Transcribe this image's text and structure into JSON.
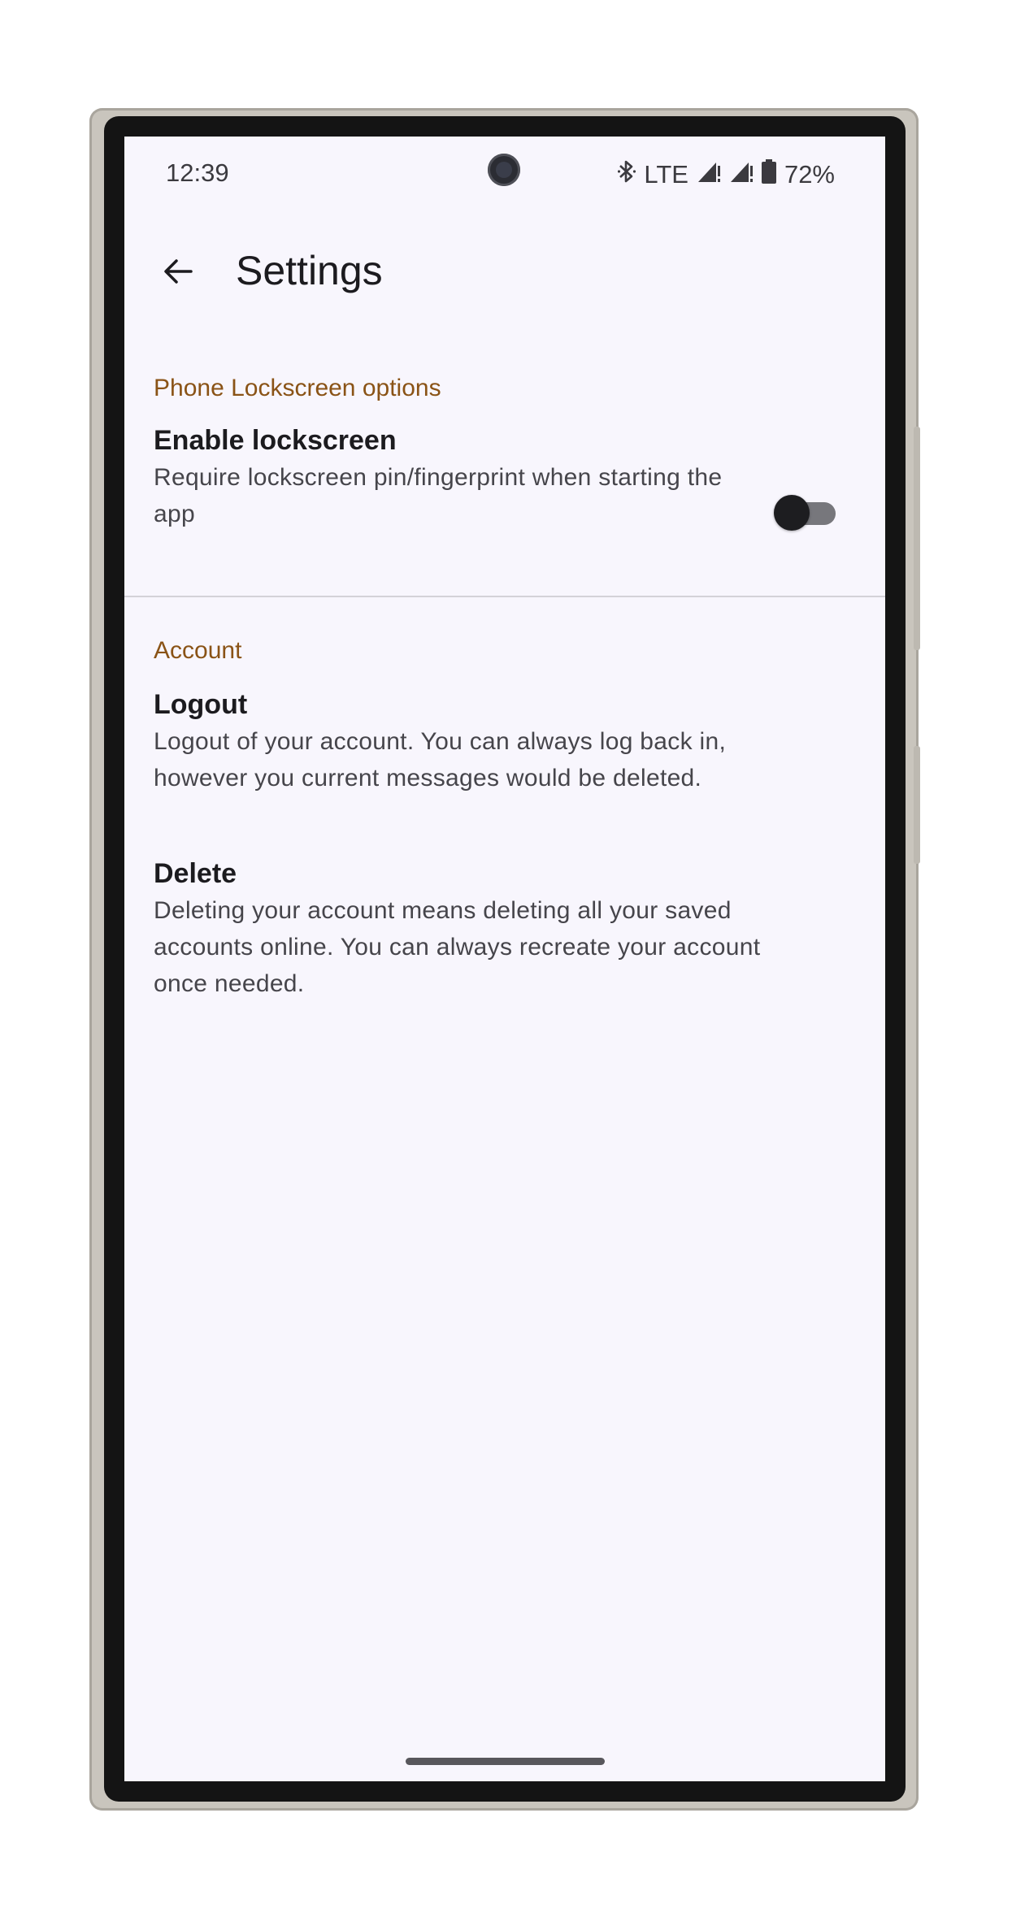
{
  "status_bar": {
    "time": "12:39",
    "network": "LTE",
    "battery_percent": "72%",
    "icons": [
      "bluetooth-icon",
      "signal-icon",
      "signal-icon",
      "battery-icon"
    ]
  },
  "app_bar": {
    "title": "Settings",
    "back_icon": "arrow-left-icon"
  },
  "sections": [
    {
      "header": "Phone Lockscreen options",
      "items": [
        {
          "title": "Enable lockscreen",
          "summary": "Require lockscreen pin/fingerprint when starting the app",
          "toggle_on": false
        }
      ]
    },
    {
      "header": "Account",
      "items": [
        {
          "title": "Logout",
          "summary": "Logout of your account. You can always log back in, however you current messages would be deleted."
        },
        {
          "title": "Delete",
          "summary": "Deleting your account means deleting all your saved accounts online. You can always recreate your account once needed."
        }
      ]
    }
  ],
  "colors": {
    "section_header": "#8a5316",
    "background": "#f8f6fd",
    "title_text": "#1c1b1f",
    "summary_text": "#46454b"
  }
}
